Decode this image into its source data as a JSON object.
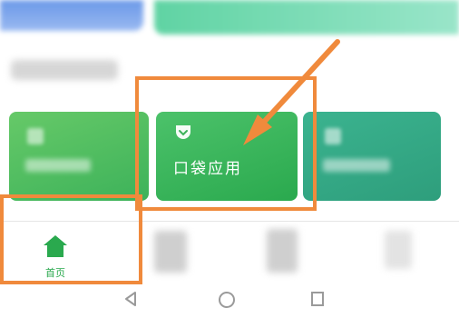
{
  "cards": {
    "main": {
      "title": "口袋应用",
      "icon": "pocket-icon"
    }
  },
  "bottom_nav": {
    "home_label": "首页",
    "home_icon": "home-icon",
    "active_color": "#2aa94e"
  },
  "system_bar": {
    "buttons": [
      "back-icon",
      "home-circle-icon",
      "recents-icon"
    ]
  },
  "annotations": {
    "highlight_color": "#f08a3c"
  }
}
